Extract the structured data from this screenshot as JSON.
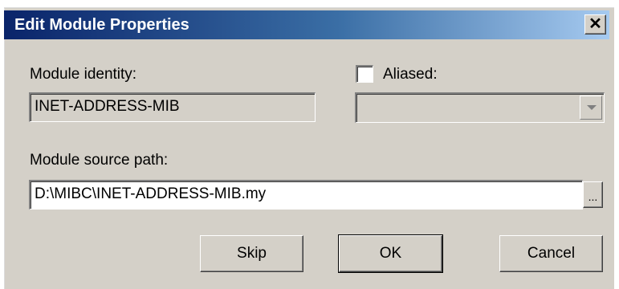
{
  "dialog": {
    "title": "Edit Module Properties",
    "close_label": "✕"
  },
  "module_identity": {
    "label": "Module identity:",
    "value": "INET-ADDRESS-MIB"
  },
  "aliased": {
    "label": "Aliased:",
    "checked": false,
    "value": ""
  },
  "source_path": {
    "label": "Module source path:",
    "value": "D:\\MIBC\\INET-ADDRESS-MIB.my",
    "browse_label": "..."
  },
  "buttons": {
    "skip": "Skip",
    "ok": "OK",
    "cancel": "Cancel"
  }
}
